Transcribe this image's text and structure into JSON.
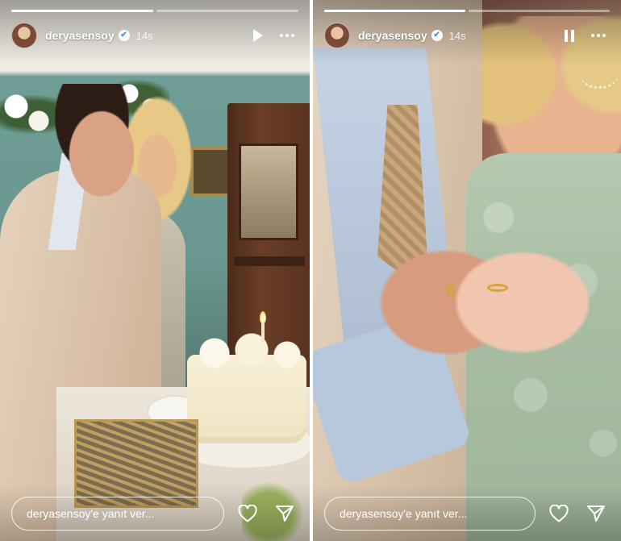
{
  "stories": [
    {
      "username": "deryasensoy",
      "verified_badge": "✔",
      "time": "14s",
      "progress": [
        1,
        0
      ],
      "playback_state": "play",
      "reply_placeholder": "deryasensoy'e yanıt ver...",
      "photo_subject": "couple-cutting-wedding-cake"
    },
    {
      "username": "deryasensoy",
      "verified_badge": "✔",
      "time": "14s",
      "progress": [
        1,
        0
      ],
      "playback_state": "pause",
      "reply_placeholder": "deryasensoy'e yanıt ver...",
      "photo_subject": "hands-with-wedding-rings"
    }
  ],
  "icons": {
    "play": "play-icon",
    "pause": "pause-icon",
    "more": "more-options-icon",
    "like": "heart-icon",
    "share": "send-icon",
    "verified": "verified-badge-icon"
  },
  "colors": {
    "chrome_text": "#ffffff",
    "verified_check": "#3897f0",
    "progress_active": "#ffffff",
    "progress_track": "rgba(255,255,255,0.45)"
  }
}
